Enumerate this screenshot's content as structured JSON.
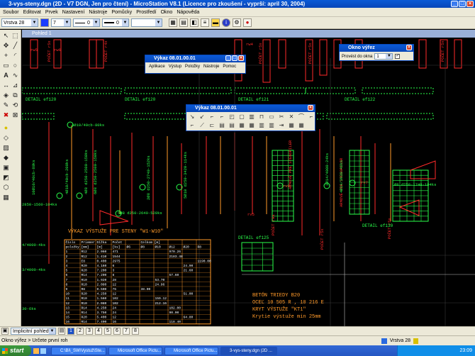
{
  "app": {
    "title": "3-vys-steny.dgn (2D - V7 DGN, Jen pro čtení) - MicroStation V8.1 (Licence pro zkoušení - vyprší: april 30, 2004)"
  },
  "menu": [
    "Soubor",
    "Editovat",
    "Prvek",
    "Nastavení",
    "Nástroje",
    "Pomůcky",
    "Prostředí",
    "Okno",
    "Nápověda"
  ],
  "toolbar": {
    "level": "Vrstva 28",
    "color": "7",
    "style": "0",
    "weight": "0"
  },
  "view": {
    "title": "Pohled 1"
  },
  "window_vykaz1": {
    "title": "Výkaz 08.01.00.01",
    "menu": [
      "Aplikace",
      "Výstup",
      "Položky",
      "Nástroje",
      "Pomoc"
    ]
  },
  "window_vykaz2": {
    "title": "Výkaz 08.01.00.01"
  },
  "window_vyrez": {
    "title": "Okno výřez",
    "label": "Provést do okna",
    "value": "1"
  },
  "drawing": {
    "labels_red": [
      "POČET r5x",
      "POČET r4x",
      "POČET r5x",
      "POČET r5x",
      "POČET r5x",
      "POČET r9a",
      "POČET r5x",
      "ARMOVÉ PRE STENOPILER",
      "ARMOVÉ PRE STENOPILER",
      "POČET r5x",
      "rw5",
      "rw6",
      "rw4",
      "rv5",
      "rv9",
      "rv7",
      "4Ø10/40cb-80ks",
      "10Ø10/40cb-80ks",
      "4Ø10/40cb-200ks",
      "4Ø8 d250-2500-150ks",
      "6Ø8 d250-2500-150ks",
      "5Ø8 d250-2640-520ks",
      "Ø8 d250-1740-104ks",
      "2Ø8 d250-2740-152ks",
      "5Ø10 d250-3420-114ks",
      "9Ø8 d250-1740-104ks",
      "5Ø12/3780-40ks",
      "9Ø13/4000-48ks",
      "4Ø14/3930-48ks",
      "10Ø14/3930-40ks",
      "8Ø10/3550-80ks",
      "7Ø8 d250-2160-48ks",
      "2850-1560-104ks",
      "4/4000-4ks",
      "3/4000-4ks",
      "2000-48ks",
      "30-6ks",
      "3Ø14/4000-24ks",
      "4Ø8 d250-1740-104ks"
    ],
    "detail_labels": [
      "DETAIL ef120",
      "DETAIL ef120",
      "DETAIL ef121",
      "DETAIL ef122",
      "DETAIL ef125",
      "DETAIL ef130"
    ],
    "table_title": "VÝKAZ VÝSTUŽE PRE STENY \"W1-W10\"",
    "table_headers": [
      "Číslo",
      "Priemer",
      "Dĺžka",
      "Počet",
      "",
      "Celkom [m]",
      "",
      "",
      "",
      ""
    ],
    "table_subheaders": [
      "položky",
      "[mm]",
      "[m]",
      "[ks]",
      "Ø6",
      "Ø8",
      "Ø10",
      "Ø12",
      "Ø20",
      "R8"
    ],
    "table_rows": [
      [
        "1",
        "R12",
        "2.060",
        "471",
        "",
        "",
        "",
        "970.26",
        "",
        ""
      ],
      [
        "2",
        "R12",
        "1.410",
        "1544",
        "",
        "",
        "",
        "2183.48",
        "",
        ""
      ],
      [
        "3",
        "E8",
        "0.400",
        "2975",
        "",
        "",
        "",
        "",
        "",
        "1190.00"
      ],
      [
        "4",
        "R20",
        "4.160",
        "6",
        "",
        "",
        "",
        "",
        "24.90",
        ""
      ],
      [
        "5",
        "R20",
        "7.200",
        "3",
        "",
        "",
        "",
        "",
        "21.60",
        ""
      ],
      [
        "6",
        "R14",
        "7.200",
        "8",
        "",
        "",
        "",
        "57.60",
        "",
        ""
      ],
      [
        "7",
        "R10",
        "1.920",
        "28",
        "",
        "",
        "53.70",
        "",
        "",
        ""
      ],
      [
        "8",
        "R10",
        "2.080",
        "12",
        "",
        "",
        "24.96",
        "",
        "",
        ""
      ],
      [
        "9",
        "R8",
        "0.500",
        "76",
        "",
        "38.00",
        "",
        "",
        "",
        ""
      ],
      [
        "10",
        "R20",
        "4.250",
        "12",
        "",
        "",
        "",
        "",
        "51.00",
        ""
      ],
      [
        "11",
        "R10",
        "1.560",
        "102",
        "",
        "",
        "159.12",
        "",
        "",
        ""
      ],
      [
        "12",
        "R10",
        "2.080",
        "102",
        "",
        "",
        "212.16",
        "",
        "",
        ""
      ],
      [
        "13",
        "R14",
        "4.250",
        "24",
        "",
        "",
        "",
        "102.00",
        "",
        ""
      ],
      [
        "14",
        "R14",
        "3.750",
        "24",
        "",
        "",
        "",
        "90.00",
        "",
        ""
      ],
      [
        "15",
        "R20",
        "5.400",
        "12",
        "",
        "",
        "",
        "",
        "64.80",
        ""
      ],
      [
        "16",
        "R14",
        "7.400",
        "16",
        "",
        "",
        "",
        "118.40",
        "",
        ""
      ]
    ],
    "notes": [
      "BETÓN TRIEDY B20",
      "OCEĽ 10 505 R , 10 216 E",
      "KRYT VÝSTUŽE \"KT1\"",
      "Krytie výstuže min 25mm"
    ]
  },
  "bottombar": {
    "view_name": "Implicitní pohledy",
    "pages": [
      "1",
      "2",
      "3",
      "4",
      "5",
      "6",
      "7",
      "8"
    ]
  },
  "status": {
    "prompt": "Okno výřez > Určete první roh",
    "level": "Vrstva 28"
  },
  "taskbar": {
    "start": "start",
    "tasks": [
      "C:\\Bi\\_SW\\Vystuž\\Ste...",
      "Microsoft Office Pictu...",
      "Microsoft Office Pictu...",
      "3-vys-steny.dgn (2D ..."
    ],
    "clock": "23:09"
  },
  "colors": {
    "drawing_bg": "#000000",
    "red": "#ff2a2a",
    "green": "#2aff4a",
    "yellow": "#ffff00",
    "orange": "#ff9a2a",
    "white": "#ffffff"
  }
}
